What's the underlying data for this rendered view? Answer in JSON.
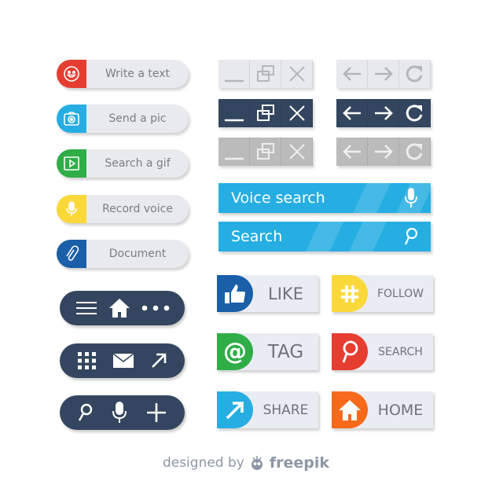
{
  "action_pills": [
    {
      "label": "Write a text",
      "icon": "smiley-icon",
      "color": "#e53e30"
    },
    {
      "label": "Send a pic",
      "icon": "camera-icon",
      "color": "#26aee2"
    },
    {
      "label": "Search a gif",
      "icon": "play-icon",
      "color": "#2fae47"
    },
    {
      "label": "Record voice",
      "icon": "microphone-icon",
      "color": "#fbd83a"
    },
    {
      "label": "Document",
      "icon": "paperclip-icon",
      "color": "#1a5fa8"
    }
  ],
  "icon_pills": [
    [
      "menu-icon",
      "home-icon",
      "more-icon"
    ],
    [
      "grid-icon",
      "mail-icon",
      "arrow-up-right-icon"
    ],
    [
      "search-icon",
      "microphone-icon",
      "plus-icon"
    ]
  ],
  "window_controls": {
    "icons": [
      "minimize-icon",
      "restore-icon",
      "close-icon"
    ],
    "variants": [
      "light",
      "dark",
      "gray"
    ]
  },
  "nav_controls": {
    "icons": [
      "arrow-left-icon",
      "arrow-right-icon",
      "refresh-icon"
    ]
  },
  "colors": {
    "light": "#e8e9ec",
    "dark": "#34465f",
    "gray": "#bbbbbb",
    "blue": "#26aee2"
  },
  "voice_search": {
    "label": "Voice search",
    "icon": "microphone-icon"
  },
  "search": {
    "label": "Search",
    "icon": "search-icon"
  },
  "social": [
    {
      "label": "LIKE",
      "icon": "thumbs-up-icon",
      "color": "#1a5fa8"
    },
    {
      "label": "FOLLOW",
      "icon": "hashtag-icon",
      "color": "#fbd83a"
    },
    {
      "label": "TAG",
      "icon": "at-icon",
      "color": "#2fae47"
    },
    {
      "label": "SEARCH",
      "icon": "search-icon",
      "color": "#e53e30"
    },
    {
      "label": "SHARE",
      "icon": "arrow-up-right-icon",
      "color": "#26aee2"
    },
    {
      "label": "HOME",
      "icon": "home-icon",
      "color": "#f76a1c"
    }
  ],
  "footer": {
    "prefix": "designed by",
    "brand": "freepik"
  }
}
